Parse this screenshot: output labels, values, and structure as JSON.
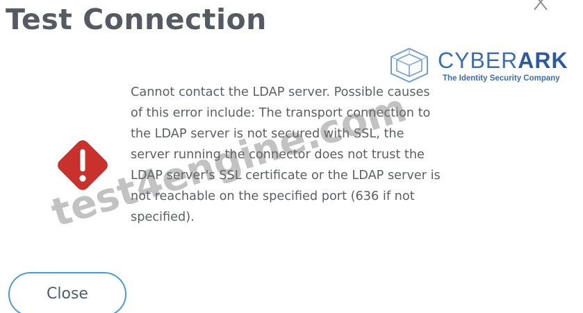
{
  "dialog": {
    "title": "Test Connection",
    "close_icon": "close-icon",
    "message": "Cannot contact the LDAP server. Possible causes\nof this error include: The transport connection to\nthe LDAP server is not secured with SSL, the\nserver running the connector does not trust the\nLDAP server's SSL certificate or the LDAP server is\nnot reachable on the specified port (636 if not\nspecified).",
    "error_icon": "warning-diamond-icon",
    "close_button_label": "Close"
  },
  "brand": {
    "name_light": "CYBER",
    "name_bold": "ARK",
    "tagline": "The Identity Security Company",
    "icon": "cyberark-logo-icon"
  },
  "watermark": {
    "text": "test4engine.com"
  },
  "colors": {
    "title_text": "#555b60",
    "body_text": "#5a5f64",
    "error_red": "#c8312c",
    "button_border": "#4a9ad8",
    "brand_blue": "#3a6db5"
  }
}
